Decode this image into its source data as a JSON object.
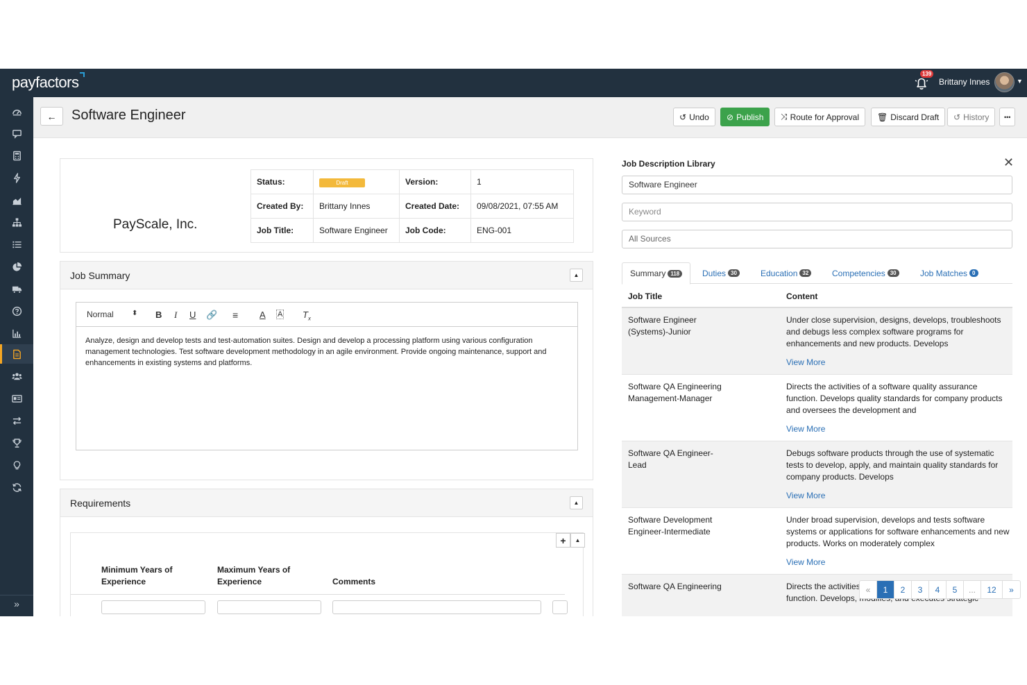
{
  "brand": {
    "name": "payfactors",
    "accent": "#2a9fd8"
  },
  "topbar": {
    "notification_count": "139",
    "user_name": "Brittany Innes"
  },
  "sidebar": {
    "items": [
      "dashboard-icon",
      "chat-icon",
      "calculator-icon",
      "bolt-icon",
      "area-chart-icon",
      "org-chart-icon",
      "list-icon",
      "pie-chart-icon",
      "truck-icon",
      "help-icon",
      "bar-chart-icon",
      "document-icon",
      "users-icon",
      "id-card-icon",
      "exchange-icon",
      "trophy-icon",
      "lightbulb-icon",
      "refresh-icon"
    ],
    "active_item": "document-icon",
    "expand_label": "»"
  },
  "header": {
    "title": "Software Engineer",
    "back_label": "←",
    "buttons": {
      "undo": "Undo",
      "publish": "Publish",
      "route": "Route for Approval",
      "discard": "Discard Draft",
      "history": "History",
      "more": "•••"
    }
  },
  "company": {
    "name": "PayScale, Inc.",
    "status_label": "Status:",
    "status_value": "Draft",
    "version_label": "Version:",
    "version_value": "1",
    "created_by_label": "Created By:",
    "created_by_value": "Brittany Innes",
    "created_date_label": "Created Date:",
    "created_date_value": "09/08/2021, 07:55 AM",
    "job_title_label": "Job Title:",
    "job_title_value": "Software Engineer",
    "job_code_label": "Job Code:",
    "job_code_value": "ENG-001"
  },
  "job_summary": {
    "title": "Job Summary",
    "format_select": "Normal",
    "text": "Analyze, design and develop tests and test-automation suites. Design and develop a processing platform using various configuration management technologies. Test software development methodology in an agile environment. Provide ongoing maintenance, support and enhancements in existing systems and platforms."
  },
  "requirements": {
    "title": "Requirements",
    "columns": [
      "Minimum Years of Experience",
      "Maximum Years of Experience",
      "Comments"
    ]
  },
  "library": {
    "title": "Job Description Library",
    "search_value": "Software Engineer",
    "keyword_placeholder": "Keyword",
    "sources_value": "All Sources",
    "tabs": [
      {
        "label": "Summary",
        "count": "118"
      },
      {
        "label": "Duties",
        "count": "30"
      },
      {
        "label": "Education",
        "count": "32"
      },
      {
        "label": "Competencies",
        "count": "30"
      },
      {
        "label": "Job Matches",
        "count": "0"
      }
    ],
    "columns": {
      "job_title": "Job Title",
      "content": "Content"
    },
    "view_more": "View More",
    "rows": [
      {
        "title": "Software Engineer (Systems)-Junior",
        "content": "Under close supervision, designs, develops, troubleshoots and debugs less complex software programs for enhancements and new products. Develops"
      },
      {
        "title": "Software QA Engineering Management-Manager",
        "content": "Directs the activities of a software quality assurance function. Develops quality standards for company products and oversees the development and"
      },
      {
        "title": "Software QA Engineer-Lead",
        "content": "Debugs software products through the use of systematic tests to develop, apply, and maintain quality standards for company products. Develops"
      },
      {
        "title": "Software Development Engineer-Intermediate",
        "content": "Under broad supervision, develops and tests software systems or applications for software enhancements and new products. Works on moderately complex"
      },
      {
        "title": "Software QA Engineering",
        "content": "Directs the activities of a software quality assurance function. Develops, modifies, and executes strategic"
      }
    ],
    "pager": [
      "«",
      "1",
      "2",
      "3",
      "4",
      "5",
      "...",
      "12",
      "»"
    ],
    "current_page": "1"
  }
}
